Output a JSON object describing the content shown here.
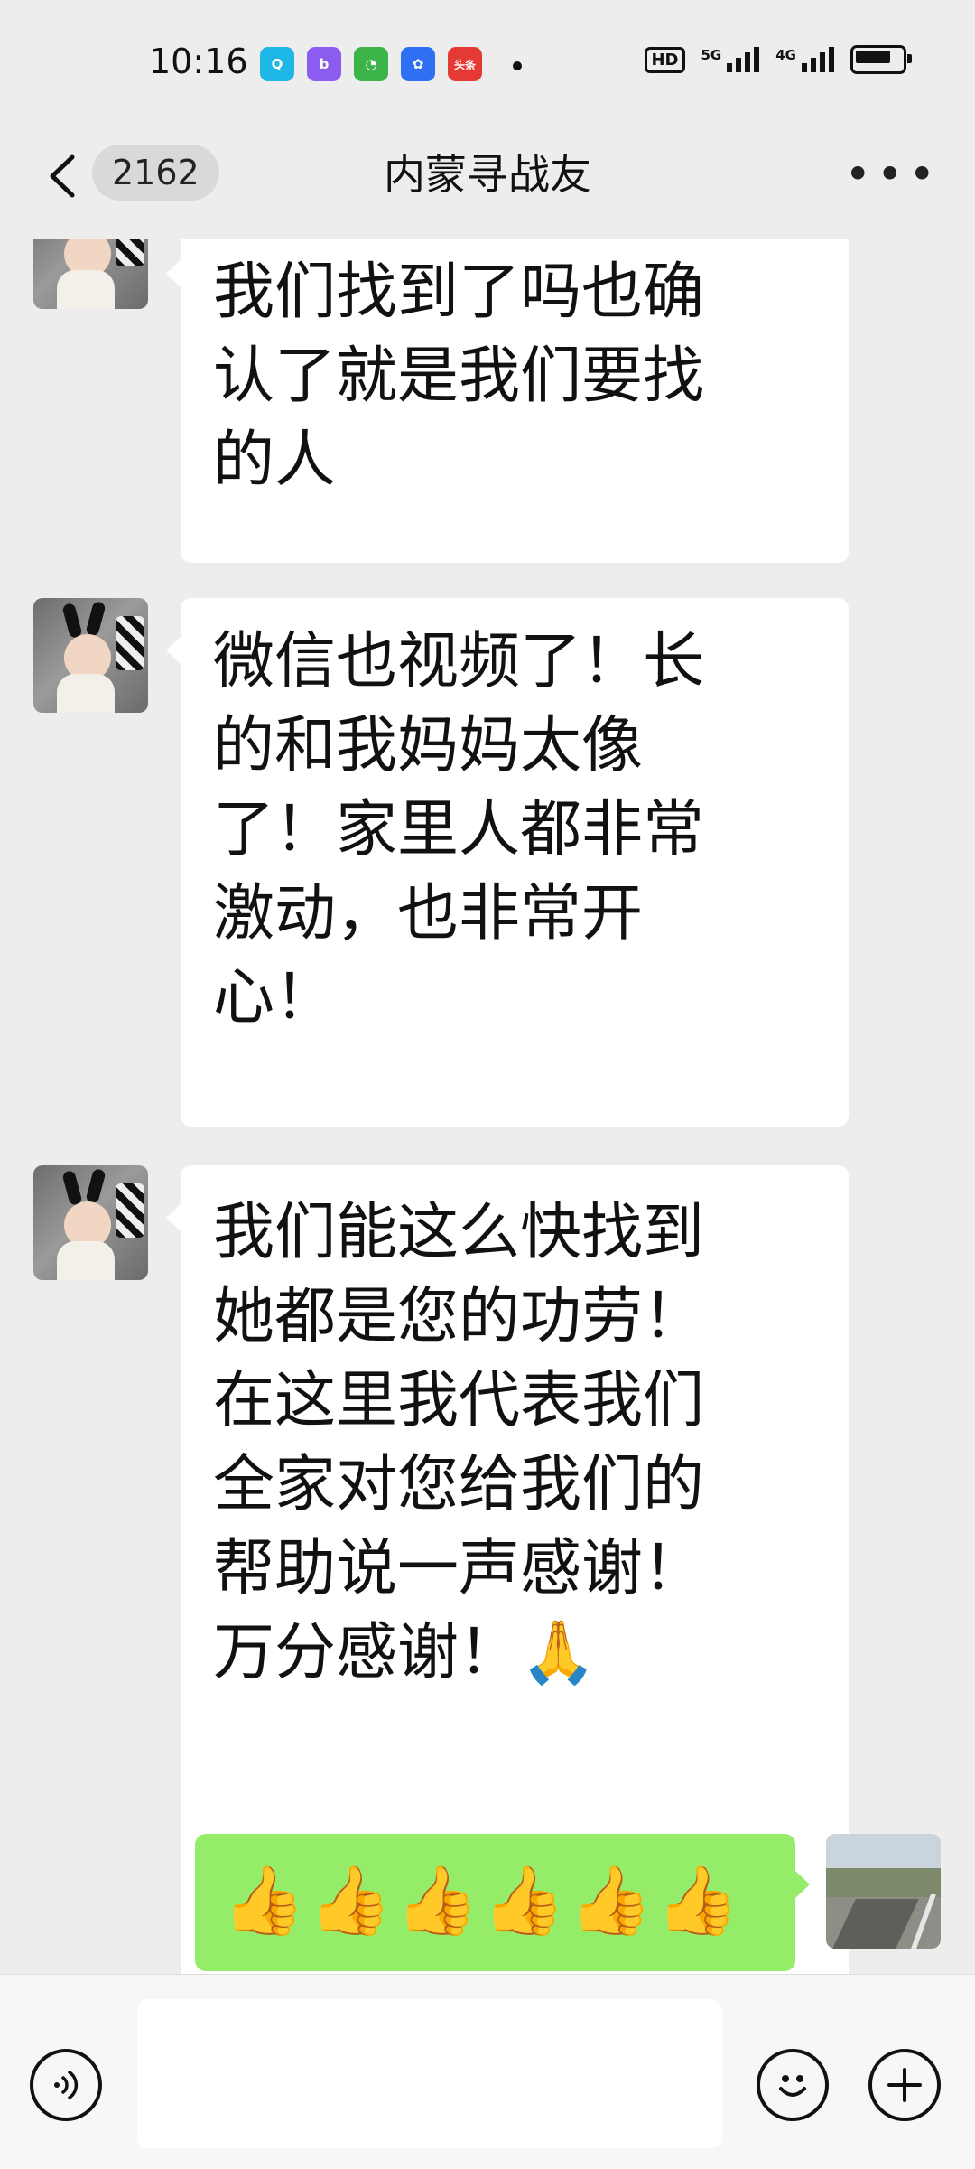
{
  "status_bar": {
    "time": "10:16",
    "app_icons": [
      {
        "name": "qq-browser-icon",
        "color": "#1fb7e6",
        "glyph": "Q"
      },
      {
        "name": "bilibili-icon",
        "color": "#8c5cf0",
        "glyph": "b"
      },
      {
        "name": "360-icon",
        "color": "#3cb44a",
        "glyph": "◔"
      },
      {
        "name": "baidu-icon",
        "color": "#2f6ff3",
        "glyph": "✿"
      },
      {
        "name": "toutiao-icon",
        "color": "#e53935",
        "glyph": "头条"
      }
    ],
    "hd_label": "HD",
    "network_1": "5G",
    "network_2": "4G"
  },
  "nav": {
    "back_icon": "chevron-left-icon",
    "unread_count": "2162",
    "title": "内蒙寻战友",
    "more_icon": "more-dots-icon"
  },
  "messages": [
    {
      "side": "left",
      "text": "我们找到了吗也确\n认了就是我们要找\n的人"
    },
    {
      "side": "left",
      "text": "微信也视频了！长\n的和我妈妈太像\n了！家里人都非常\n激动，也非常开\n心！"
    },
    {
      "side": "left",
      "text": "我们能这么快找到\n她都是您的功劳！\n在这里我代表我们\n全家对您给我们的\n帮助说一声感谢！\n万分感谢！🙏"
    },
    {
      "side": "right",
      "text": "👍👍👍👍👍👍"
    }
  ],
  "input_bar": {
    "voice_icon": "voice-icon",
    "emoji_icon": "emoji-icon",
    "plus_icon": "plus-icon"
  },
  "colors": {
    "background": "#ededed",
    "bubble_incoming": "#ffffff",
    "bubble_outgoing": "#95ec69"
  }
}
